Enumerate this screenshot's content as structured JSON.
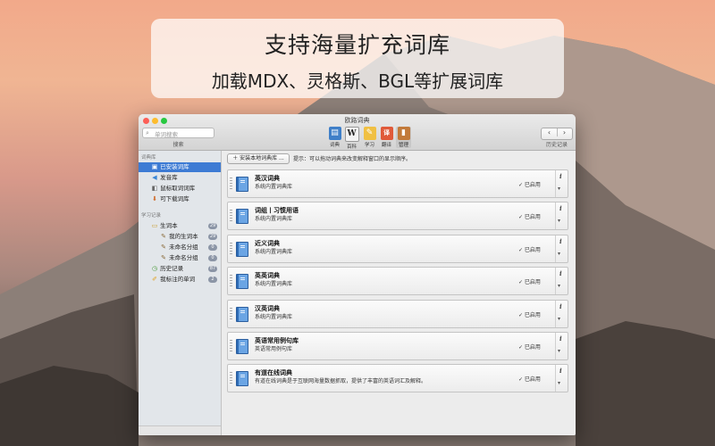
{
  "banner": {
    "title": "支持海量扩充词库",
    "subtitle": "加载MDX、灵格斯、BGL等扩展词库"
  },
  "window": {
    "title": "欧路词典",
    "traffic_lights": [
      "#fc5f57",
      "#fdbc2e",
      "#28c840"
    ]
  },
  "toolbar": {
    "search_placeholder": "单词搜索",
    "search_caption": "搜索",
    "tools": [
      {
        "label": "词典",
        "icon": "dictionary-book-icon",
        "glyph": "▤",
        "color": "#3f7fc8"
      },
      {
        "label": "百科",
        "icon": "wikipedia-icon",
        "glyph": "W",
        "color": "#f4f4f4"
      },
      {
        "label": "学习",
        "icon": "study-note-icon",
        "glyph": "✎",
        "color": "#f0c043"
      },
      {
        "label": "翻译",
        "icon": "translate-icon",
        "glyph": "译",
        "color": "#e05a3a"
      },
      {
        "label": "管理",
        "icon": "manage-library-icon",
        "glyph": "▮",
        "color": "#c27a3a"
      }
    ],
    "nav_caption": "历史记录",
    "back_glyph": "‹",
    "forward_glyph": "›"
  },
  "sidebar": {
    "section1": "词典库",
    "library": [
      {
        "label": "已安装词库",
        "icon": "installed-library-icon",
        "glyph": "▣"
      },
      {
        "label": "发音库",
        "icon": "speaker-icon",
        "glyph": "◀"
      },
      {
        "label": "鼠标取词词库",
        "icon": "mouse-icon",
        "glyph": "◧"
      },
      {
        "label": "可下载词库",
        "icon": "download-icon",
        "glyph": "⬇"
      }
    ],
    "section2": "学习记录",
    "study": [
      {
        "label": "生词本",
        "icon": "notebook-icon",
        "glyph": "▭",
        "count": "29"
      },
      {
        "label": "我的生词本",
        "icon": "pencil-icon",
        "glyph": "✎",
        "count": "29"
      },
      {
        "label": "未命名分组",
        "icon": "pencil-icon",
        "glyph": "✎",
        "count": "0"
      },
      {
        "label": "未命名分组",
        "icon": "pencil-icon",
        "glyph": "✎",
        "count": "0"
      },
      {
        "label": "历史记录",
        "icon": "clock-icon",
        "glyph": "◷",
        "count": "87"
      },
      {
        "label": "我标注的单词",
        "icon": "highlighter-icon",
        "glyph": "✐",
        "count": "2"
      }
    ]
  },
  "main": {
    "add_button": "＋ 安装本地词典库 ...",
    "hint": "提示：可以拖动词典来改变解释窗口的显示顺序。",
    "dictionaries": [
      {
        "title": "英汉词典",
        "subtitle": "系统内置词典库",
        "status": "✓ 已启用"
      },
      {
        "title": "词组丨习惯用语",
        "subtitle": "系统内置词典库",
        "status": "✓ 已启用"
      },
      {
        "title": "近义词典",
        "subtitle": "系统内置词典库",
        "status": "✓ 已启用"
      },
      {
        "title": "英英词典",
        "subtitle": "系统内置词典库",
        "status": "✓ 已启用"
      },
      {
        "title": "汉英词典",
        "subtitle": "系统内置词典库",
        "status": "✓ 已启用"
      },
      {
        "title": "英语常用例句库",
        "subtitle": "英语常用例句库",
        "status": "✓ 已启用"
      },
      {
        "title": "有道在线词典",
        "subtitle": "有道在线词典是于互联网海量数据抓取，提供了丰富的英语词汇及解释。",
        "status": "✓ 已启用"
      }
    ]
  }
}
